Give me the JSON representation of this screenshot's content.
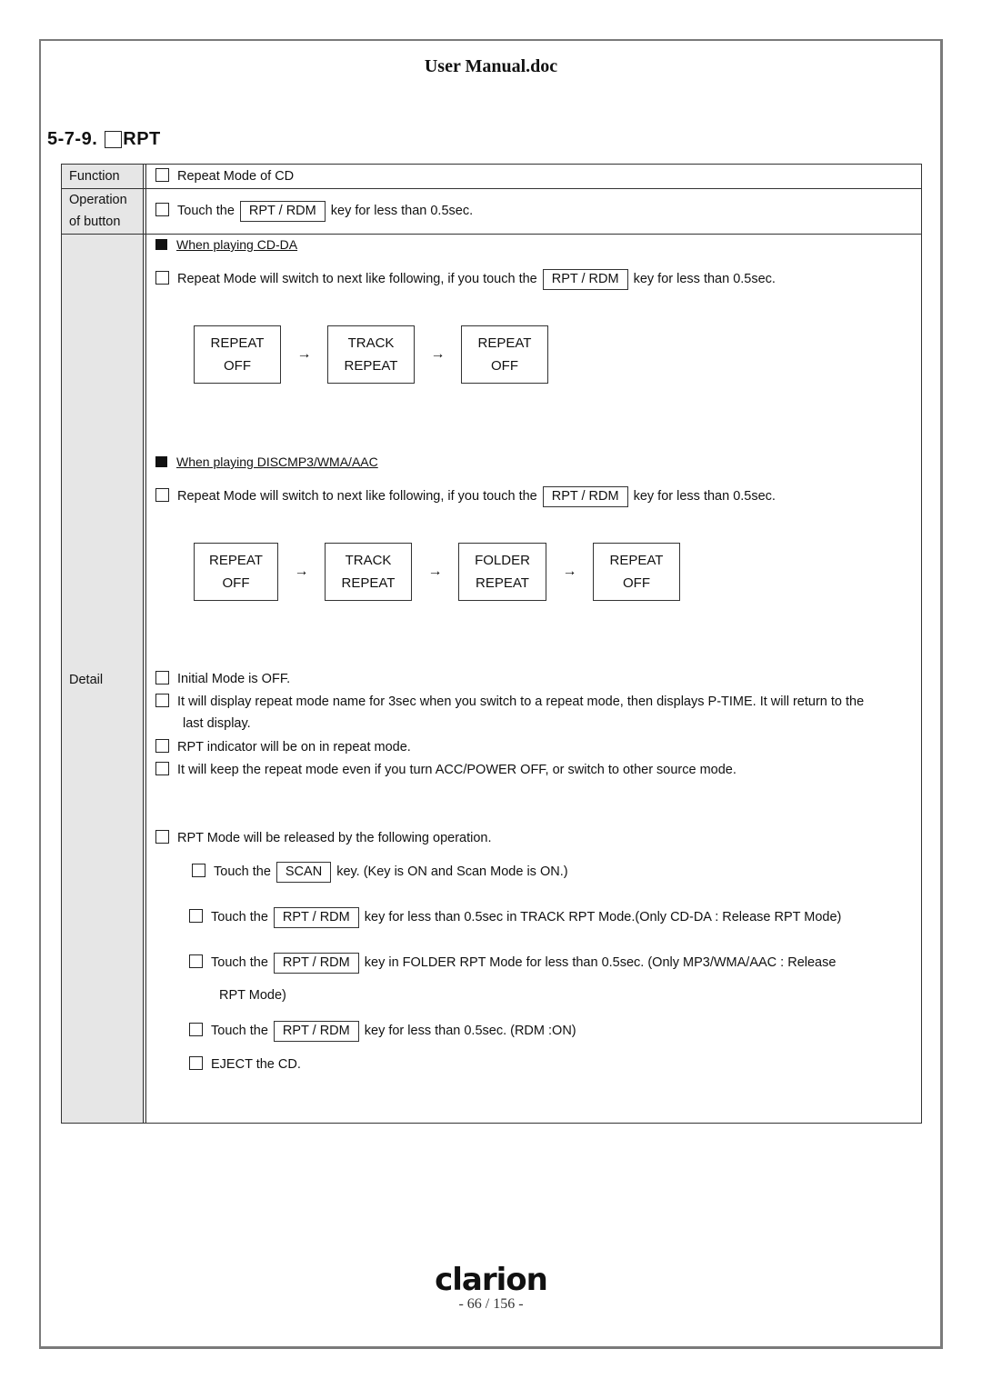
{
  "document": {
    "title": "User Manual.doc",
    "section": {
      "number": "5-7-9.",
      "name": "RPT"
    },
    "footer": {
      "logo": "clarion",
      "page": "- 66 / 156 -"
    }
  },
  "table": {
    "function": {
      "label": "Function",
      "text": "Repeat Mode of CD"
    },
    "operation": {
      "label_line1": "Operation",
      "label_line2": "of button",
      "pre": "Touch the",
      "key": "RPT / RDM",
      "post": "key for less than 0.5sec."
    },
    "detail": {
      "label": "Detail",
      "cdda": {
        "heading": "When playing CD-DA",
        "pre": "Repeat Mode will switch to next like following, if you touch the",
        "key": "RPT / RDM",
        "post": "key for less than 0.5sec.",
        "flow": [
          {
            "line1": "REPEAT",
            "line2": "OFF"
          },
          {
            "line1": "TRACK",
            "line2": "REPEAT"
          },
          {
            "line1": "REPEAT",
            "line2": "OFF"
          }
        ]
      },
      "mp3": {
        "heading": "When playing DISCMP3/WMA/AAC",
        "pre": "Repeat Mode will switch to next like following, if you touch the",
        "key": "RPT / RDM",
        "post": "key for less than 0.5sec.",
        "flow": [
          {
            "line1": "REPEAT",
            "line2": "OFF"
          },
          {
            "line1": "TRACK",
            "line2": "REPEAT"
          },
          {
            "line1": "FOLDER",
            "line2": "REPEAT"
          },
          {
            "line1": "REPEAT",
            "line2": "OFF"
          }
        ]
      },
      "arrow": "→",
      "notes": [
        "Initial Mode is OFF.",
        "It will display repeat mode name for 3sec when you switch to a repeat mode, then displays P-TIME. It will return to the",
        "last display.",
        "RPT indicator will be on in repeat mode.",
        "It will keep the repeat mode even if you turn ACC/POWER  OFF, or switch to other source mode."
      ],
      "release": {
        "intro": "RPT Mode will be released by the following operation.",
        "items": [
          {
            "pre": "Touch the",
            "key": "SCAN",
            "post": "key.    (Key is ON and Scan Mode is ON.)"
          },
          {
            "pre": "Touch the",
            "key": "RPT / RDM",
            "post": "key for less than 0.5sec in TRACK RPT Mode.(Only CD-DA  :  Release RPT Mode)"
          },
          {
            "pre": "Touch the",
            "key": "RPT / RDM",
            "post": "key in FOLDER RPT Mode for less than 0.5sec. (Only MP3/WMA/AAC  :  Release",
            "cont": "RPT Mode)"
          },
          {
            "pre": "Touch the",
            "key": "RPT / RDM",
            "post": "key for less than 0.5sec.    (RDM :ON)"
          },
          {
            "pre": "EJECT the CD."
          }
        ]
      }
    }
  }
}
